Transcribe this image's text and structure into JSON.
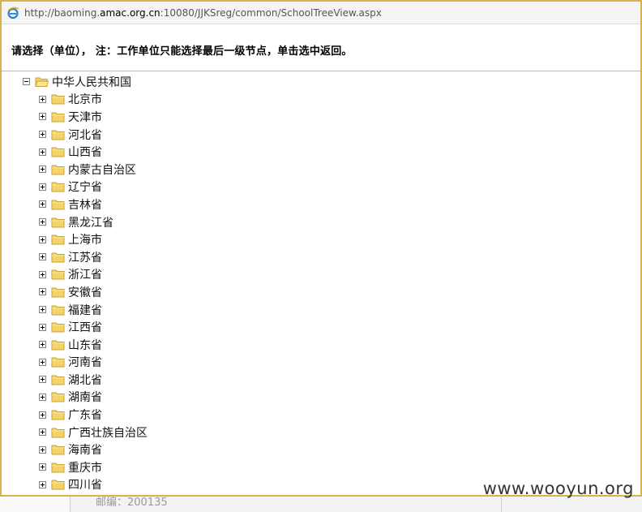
{
  "address_bar": {
    "url_prefix": "http://baoming.",
    "url_domain": "amac.org.cn",
    "url_suffix": ":10080/JJKSreg/common/SchoolTreeView.aspx",
    "icon": "ie-icon"
  },
  "instruction": "请选择（单位）， 注：工作单位只能选择最后一级节点，单击选中返回。",
  "tree": {
    "root": {
      "label": "中华人民共和国",
      "expanded": true
    },
    "children": [
      "北京市",
      "天津市",
      "河北省",
      "山西省",
      "内蒙古自治区",
      "辽宁省",
      "吉林省",
      "黑龙江省",
      "上海市",
      "江苏省",
      "浙江省",
      "安徽省",
      "福建省",
      "江西省",
      "山东省",
      "河南省",
      "湖北省",
      "湖南省",
      "广东省",
      "广西壮族自治区",
      "海南省",
      "重庆市",
      "四川省"
    ]
  },
  "bottom": {
    "partial_text": "邮编：200135"
  },
  "watermark": "www.wooyun.org",
  "colors": {
    "window_border": "#d8b24a",
    "folder_fill": "#f3d36b",
    "folder_stroke": "#c9a334"
  }
}
